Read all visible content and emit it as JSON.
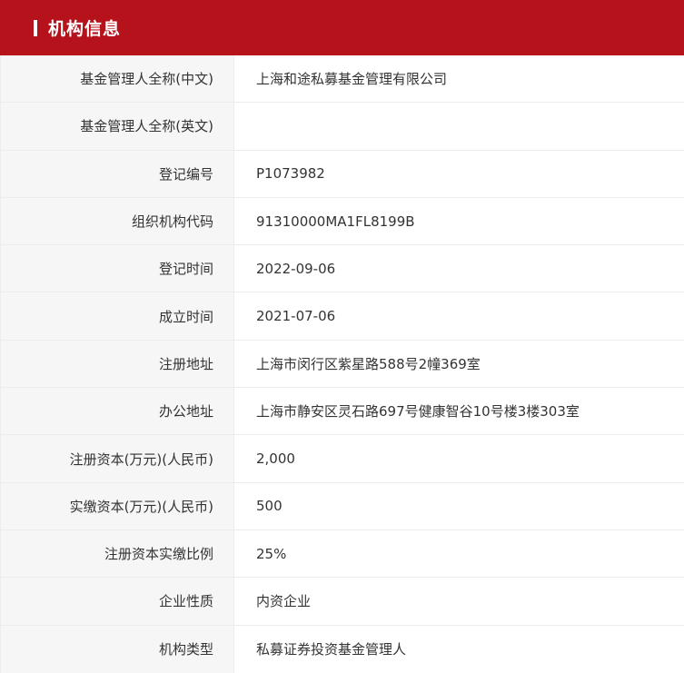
{
  "header": {
    "title": "机构信息"
  },
  "colors": {
    "header_bg": "#b5121b",
    "label_bg": "#f6f6f6",
    "border": "#ececec",
    "text": "#333333"
  },
  "rows": [
    {
      "label": "基金管理人全称(中文)",
      "value": "上海和途私募基金管理有限公司"
    },
    {
      "label": "基金管理人全称(英文)",
      "value": ""
    },
    {
      "label": "登记编号",
      "value": "P1073982"
    },
    {
      "label": "组织机构代码",
      "value": "91310000MA1FL8199B"
    },
    {
      "label": "登记时间",
      "value": "2022-09-06"
    },
    {
      "label": "成立时间",
      "value": "2021-07-06"
    },
    {
      "label": "注册地址",
      "value": "上海市闵行区紫星路588号2幢369室"
    },
    {
      "label": "办公地址",
      "value": "上海市静安区灵石路697号健康智谷10号楼3楼303室"
    },
    {
      "label": "注册资本(万元)(人民币)",
      "value": "2,000"
    },
    {
      "label": "实缴资本(万元)(人民币)",
      "value": "500"
    },
    {
      "label": "注册资本实缴比例",
      "value": "25%"
    },
    {
      "label": "企业性质",
      "value": "内资企业"
    },
    {
      "label": "机构类型",
      "value": "私募证券投资基金管理人"
    }
  ]
}
